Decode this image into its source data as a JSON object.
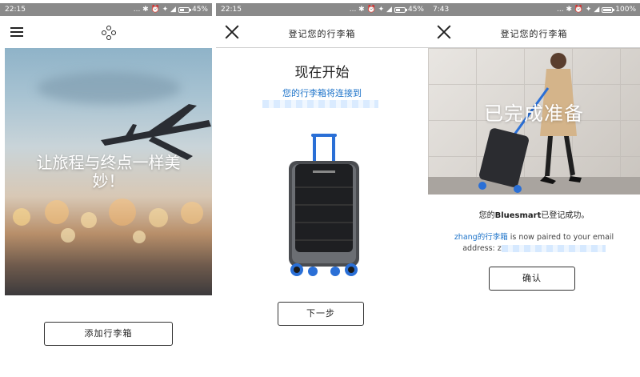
{
  "screens": [
    {
      "status": {
        "time": "22:15",
        "icons": "... ✱ ⏰ ✦ ◢",
        "battery": "45%",
        "battery_level": 0.45
      },
      "header": {
        "menu_icon": "hamburger-menu-icon",
        "logo_icon": "bluesmart-logo-icon"
      },
      "hero": {
        "tagline": "让旅程与终点一样美妙！"
      },
      "button": {
        "label": "添加行李箱"
      }
    },
    {
      "status": {
        "time": "22:15",
        "icons": "... ✱ ⏰ ✦ ◢",
        "battery": "45%",
        "battery_level": 0.45
      },
      "header": {
        "title": "登记您的行李箱",
        "close_icon": "close-icon"
      },
      "content": {
        "title": "现在开始",
        "subtitle": "您的行李箱将连接到"
      },
      "button": {
        "label": "下一步"
      }
    },
    {
      "status": {
        "time": "7:43",
        "icons": "... ✱ ⏰ ✦ ◢",
        "battery": "100%",
        "battery_level": 1.0
      },
      "header": {
        "title": "登记您的行李箱",
        "close_icon": "close-icon"
      },
      "hero": {
        "title": "已完成准备"
      },
      "content": {
        "success_prefix": "您的",
        "brand": "Bluesmart",
        "success_suffix": "已登记成功。",
        "owner": "zhang的行李箱",
        "pair_text": " is now paired to your email",
        "address_label": "address: z"
      },
      "button": {
        "label": "确认"
      }
    }
  ],
  "colors": {
    "accent_blue": "#1d73c9",
    "statusbar": "#8a8a8a",
    "suitcase_blue": "#2a6fd6"
  }
}
